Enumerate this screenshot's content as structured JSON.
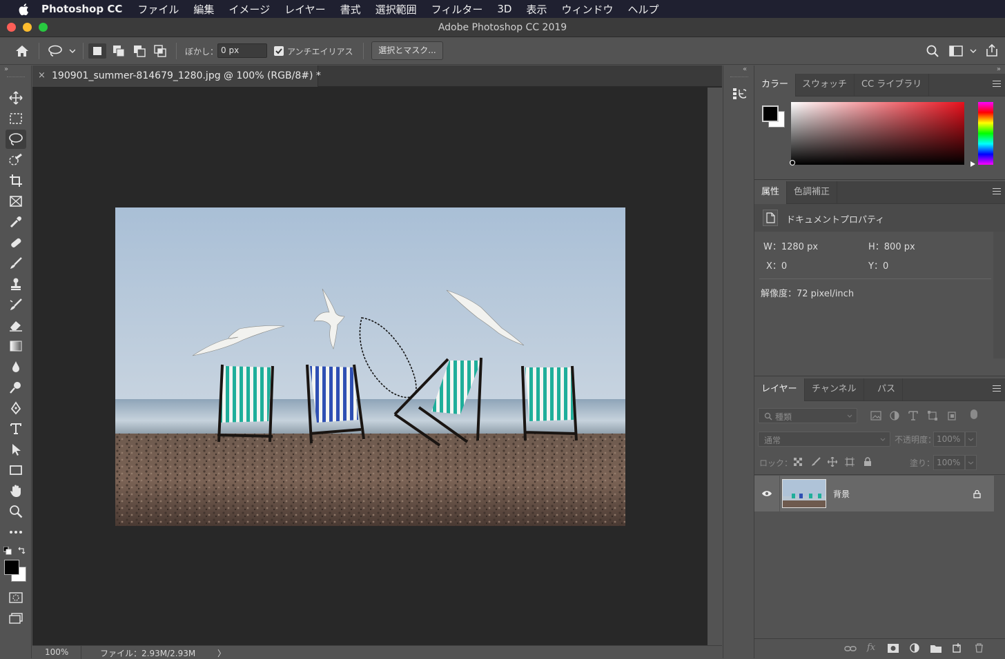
{
  "menubar": {
    "app_name": "Photoshop CC",
    "items": [
      "ファイル",
      "編集",
      "イメージ",
      "レイヤー",
      "書式",
      "選択範囲",
      "フィルター",
      "3D",
      "表示",
      "ウィンドウ",
      "ヘルプ"
    ]
  },
  "window": {
    "title": "Adobe Photoshop CC 2019",
    "traffic_colors": [
      "#fe5f57",
      "#febc2e",
      "#28c840"
    ]
  },
  "options_bar": {
    "feather_label": "ぼかし：",
    "feather_value": "0 px",
    "antialias_label": "アンチエイリアス",
    "antialias_checked": true,
    "select_mask_label": "選択とマスク..."
  },
  "document": {
    "tab_close": "×",
    "tab_title": "190901_summer-814679_1280.jpg @ 100% (RGB/8#) *",
    "zoom": "100%",
    "file_info": "ファイル：2.93M/2.93M",
    "status_arrow": "〉"
  },
  "color_panel": {
    "tabs": [
      "カラー",
      "スウォッチ",
      "CC ライブラリ"
    ],
    "hue_color": "#e8101c"
  },
  "properties_panel": {
    "tabs": [
      "属性",
      "色調補正"
    ],
    "section_title": "ドキュメントプロパティ",
    "w_label": "W：1280 px",
    "h_label": "H：800 px",
    "x_label": "X：0",
    "y_label": "Y：0",
    "resolution": "解像度：72 pixel/inch"
  },
  "layers_panel": {
    "tabs": [
      "レイヤー",
      "チャンネル",
      "パス"
    ],
    "filter_placeholder": "種類",
    "blend_mode": "通常",
    "opacity_label": "不透明度：",
    "opacity_value": "100%",
    "lock_label": "ロック：",
    "fill_label": "塗り：",
    "fill_value": "100%",
    "layers": [
      {
        "name": "背景",
        "visible": true,
        "locked": true
      }
    ]
  },
  "collapse_arrows": {
    "left": "»",
    "right": "«"
  }
}
